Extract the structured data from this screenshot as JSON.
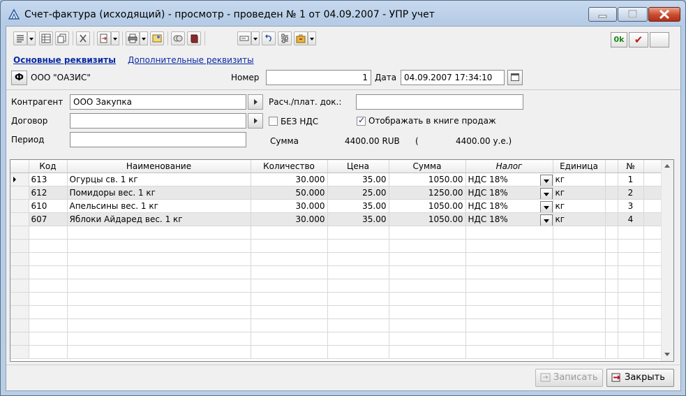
{
  "window": {
    "title": "Счет-фактура (исходящий) - просмотр - проведен № 1 от 04.09.2007 - УПР учет"
  },
  "toolbar": {
    "ok_label": "0k",
    "check_label": "✔"
  },
  "tabs": {
    "main": "Основные реквизиты",
    "additional": "Дополнительные реквизиты"
  },
  "header": {
    "f_button": "Ф",
    "organization": "ООО \"ОАЗИС\"",
    "number_label": "Номер",
    "number_value": "1",
    "date_label": "Дата",
    "date_value": "04.09.2007 17:34:10"
  },
  "form": {
    "counterparty_label": "Контрагент",
    "counterparty_value": "ООО Закупка",
    "contract_label": "Договор",
    "contract_value": "",
    "period_label": "Период",
    "period_value": "",
    "payment_doc_label": "Расч./плат. док.:",
    "payment_doc_value": "",
    "no_vat_label": "БЕЗ НДС",
    "no_vat_checked": false,
    "sales_book_label": "Отображать в книге продаж",
    "sales_book_checked": true,
    "sum_label": "Сумма",
    "sum_value": "4400.00 RUB",
    "sum_open": "(",
    "sum_ue": "4400.00 у.е.)"
  },
  "grid": {
    "columns": [
      "Код",
      "Наименование",
      "Количество",
      "Цена",
      "Сумма",
      "Налог",
      "Единица",
      "№"
    ],
    "rows": [
      {
        "code": "613",
        "name": "Огурцы св. 1 кг",
        "qty": "30.000",
        "price": "35.00",
        "sum": "1050.00",
        "tax": "НДС 18%",
        "unit": "кг",
        "no": "1"
      },
      {
        "code": "612",
        "name": "Помидоры вес. 1 кг",
        "qty": "50.000",
        "price": "25.00",
        "sum": "1250.00",
        "tax": "НДС 18%",
        "unit": "кг",
        "no": "2"
      },
      {
        "code": "610",
        "name": "Апельсины вес. 1 кг",
        "qty": "30.000",
        "price": "35.00",
        "sum": "1050.00",
        "tax": "НДС 18%",
        "unit": "кг",
        "no": "3"
      },
      {
        "code": "607",
        "name": "Яблоки Айдаред вес. 1 кг",
        "qty": "30.000",
        "price": "35.00",
        "sum": "1050.00",
        "tax": "НДС 18%",
        "unit": "кг",
        "no": "4"
      }
    ]
  },
  "buttons": {
    "save": "Записать",
    "close": "Закрыть"
  }
}
